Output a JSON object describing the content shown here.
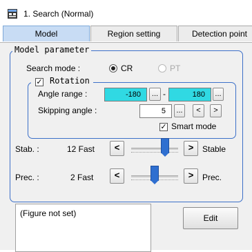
{
  "window": {
    "title": "1. Search (Normal)"
  },
  "tabs": [
    {
      "label": "Model",
      "active": true
    },
    {
      "label": "Region setting",
      "active": false
    },
    {
      "label": "Detection point",
      "active": false
    }
  ],
  "model_parameter": {
    "legend": "Model parameter",
    "search_mode_label": "Search mode :",
    "options": [
      {
        "label": "CR",
        "selected": true
      },
      {
        "label": "PT",
        "selected": false
      }
    ]
  },
  "rotation": {
    "legend": "Rotation",
    "checked": true,
    "angle_range_label": "Angle range :",
    "angle_min": "-180",
    "angle_max": "180",
    "range_separator": "-",
    "ellipsis": "...",
    "skipping_angle_label": "Skipping angle :",
    "skipping_angle": "5",
    "left_arrow": "<",
    "right_arrow": ">",
    "smart_mode_label": "Smart mode",
    "smart_mode_checked": true
  },
  "stab": {
    "label": "Stab. :",
    "value_text": "12 Fast",
    "left_btn": "<",
    "right_btn": ">",
    "right_label": "Stable",
    "level": 0.72
  },
  "prec": {
    "label": "Prec. :",
    "value_text": "2 Fast",
    "left_btn": "<",
    "right_btn": ">",
    "right_label": "Prec.",
    "level": 0.5
  },
  "figure": {
    "text": "(Figure not set)"
  },
  "edit_button": {
    "label": "Edit"
  },
  "icons": {
    "window": "app-window-icon"
  }
}
